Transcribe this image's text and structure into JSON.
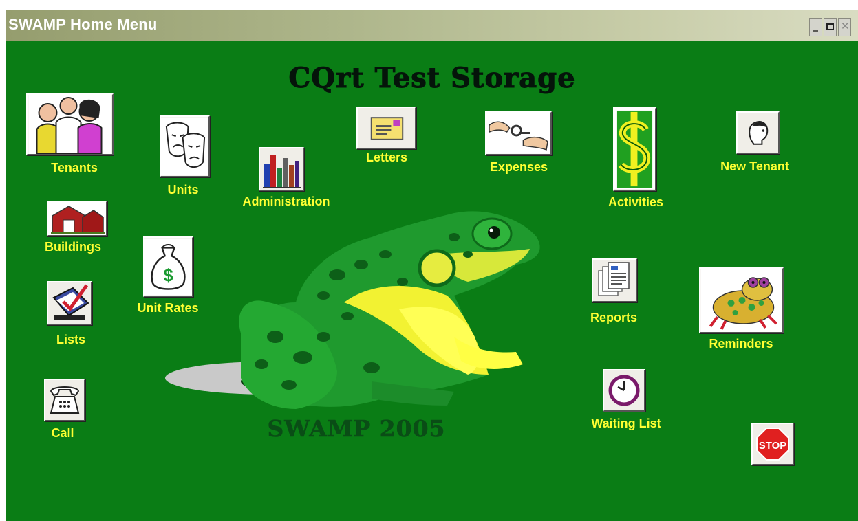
{
  "window": {
    "title": "SWAMP Home Menu"
  },
  "app": {
    "title": "CQrt Test Storage",
    "footer": "SWAMP 2005"
  },
  "menu": {
    "tenants": "Tenants",
    "units": "Units",
    "administration": "Administration",
    "letters": "Letters",
    "expenses": "Expenses",
    "activities": "Activities",
    "new_tenant": "New Tenant",
    "buildings": "Buildings",
    "unit_rates": "Unit Rates",
    "lists": "Lists",
    "call": "Call",
    "reports": "Reports",
    "reminders": "Reminders",
    "waiting_list": "Waiting List",
    "stop": "STOP"
  },
  "colors": {
    "background": "#0a7d15",
    "label": "#ffff33",
    "title_text": "#05140a",
    "titlebar": "#aeb68b"
  },
  "icons": {
    "tenants": "people-icon",
    "units": "theater-masks-icon",
    "administration": "books-icon",
    "letters": "envelope-icon",
    "expenses": "hand-keys-icon",
    "activities": "dollar-sign-icon",
    "new_tenant": "person-head-icon",
    "buildings": "barn-icon",
    "unit_rates": "money-bag-icon",
    "lists": "checklist-icon",
    "call": "telephone-icon",
    "reports": "documents-icon",
    "reminders": "toad-icon",
    "waiting_list": "clock-icon",
    "stop": "stop-sign-icon"
  }
}
